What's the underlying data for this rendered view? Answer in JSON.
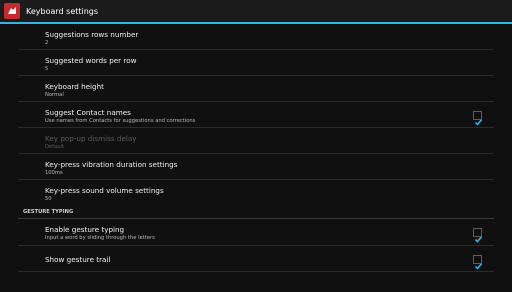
{
  "app": {
    "title": "Keyboard settings",
    "icon": "app-launcher-icon",
    "accent_color": "#33b5e5"
  },
  "preferences": [
    {
      "title": "Suggestions rows number",
      "summary": "2"
    },
    {
      "title": "Suggested words per row",
      "summary": "5"
    },
    {
      "title": "Keyboard height",
      "summary": "Normal"
    },
    {
      "title": "Suggest Contact names",
      "summary": "Use names from Contacts for suggestions and corrections",
      "checked": true
    },
    {
      "title": "Key pop-up dismiss delay",
      "summary": "Default",
      "enabled": false
    },
    {
      "title": "Key-press vibration duration settings",
      "summary": "100ms"
    },
    {
      "title": "Key-press sound volume settings",
      "summary": "50"
    }
  ],
  "gesture_section": {
    "header": "GESTURE TYPING",
    "items": [
      {
        "title": "Enable gesture typing",
        "summary": "Input a word by sliding through the letters",
        "checked": true
      },
      {
        "title": "Show gesture trail",
        "checked": true
      }
    ]
  }
}
